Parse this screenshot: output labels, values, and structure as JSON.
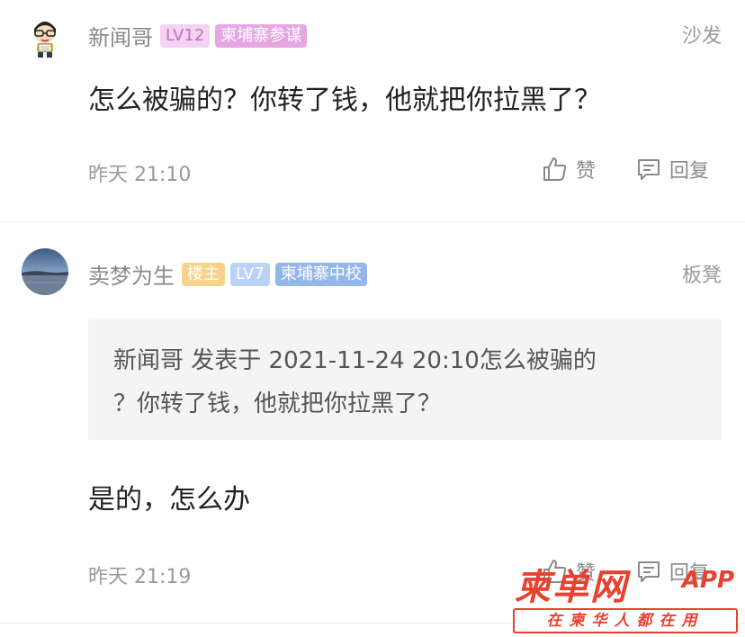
{
  "posts": [
    {
      "username": "新闻哥",
      "badges": [
        "LV12",
        "柬埔寨参谋"
      ],
      "floor": "沙发",
      "content": "怎么被骗的？你转了钱，他就把你拉黑了？",
      "time": "昨天 21:10",
      "like_label": "赞",
      "reply_label": "回复"
    },
    {
      "username": "卖梦为生",
      "badges": [
        "楼主",
        "LV7",
        "柬埔寨中校"
      ],
      "floor": "板凳",
      "quote_line1": "新闻哥 发表于 2021-11-24 20:10怎么被骗的",
      "quote_line2": "？你转了钱，他就把你拉黑了？",
      "content": "是的，怎么办",
      "time": "昨天 21:19",
      "like_label": "赞",
      "reply_label": "回复"
    }
  ],
  "watermark": {
    "title": "柬单网",
    "app": "APP",
    "slogan": "在柬华人都在用"
  },
  "colors": {
    "accent_red": "#e8412f",
    "badge_pink": "#e6a6e3",
    "badge_blue": "#93b7e9",
    "badge_gold": "#f6d28c"
  }
}
